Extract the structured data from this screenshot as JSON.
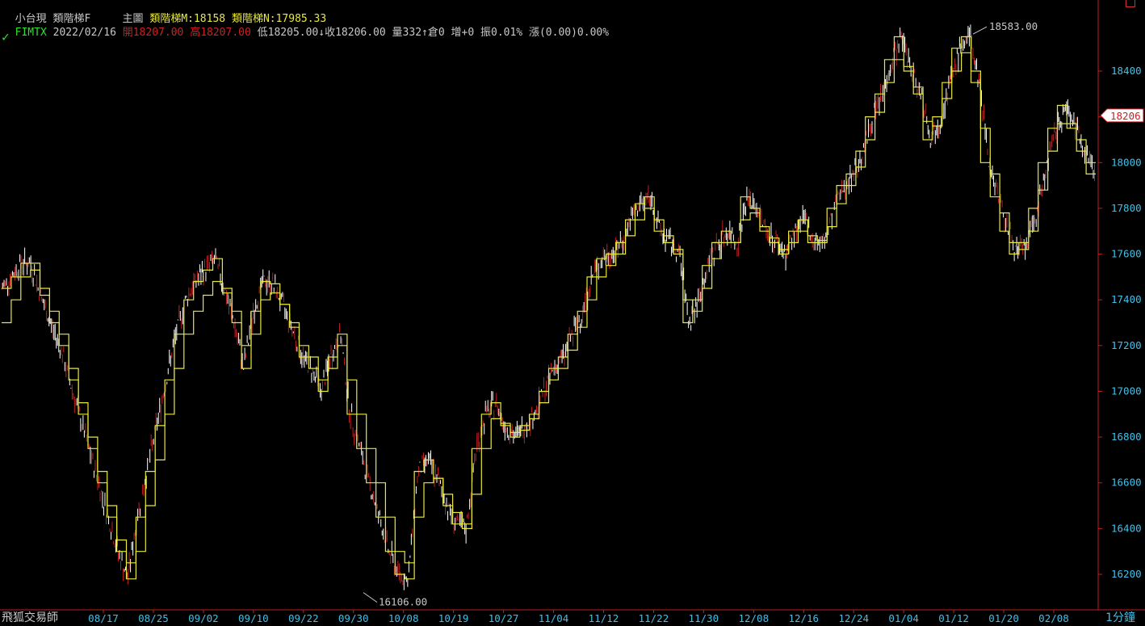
{
  "header": {
    "line1": {
      "product": "小台現",
      "indicator": "類階梯F",
      "panel": "主圖",
      "m_label": "類階梯M:18158",
      "n_label": "類階梯N:17985.33"
    },
    "line2": {
      "symbol": "FIMTX",
      "date": "2022/02/16",
      "open": "開18207.00",
      "high": "高18207.00",
      "low": "低18205.00",
      "close": "↓收18206.00",
      "volume": "量332",
      "oi": "↑倉0",
      "oi_change": "增+0",
      "amplitude": "振0.01%",
      "change": "漲(0.00)0.00%"
    }
  },
  "footer": {
    "brand": "飛狐交易師",
    "period": "1分鐘"
  },
  "colors": {
    "background": "#000000",
    "axis": "#40c0e8",
    "step_line": "#e8e840",
    "candle_up": "#ffffff",
    "candle_down": "#c02020"
  },
  "chart_data": {
    "type": "line",
    "y_range": [
      16100,
      18620
    ],
    "y_ticks": [
      16200,
      16400,
      16600,
      16800,
      17000,
      17200,
      17400,
      17600,
      17800,
      18000,
      18200,
      18400
    ],
    "x_tick_labels": [
      "08/17",
      "08/25",
      "09/02",
      "09/10",
      "09/22",
      "09/30",
      "10/08",
      "10/19",
      "10/27",
      "11/04",
      "11/12",
      "11/22",
      "11/30",
      "12/08",
      "12/16",
      "12/24",
      "01/04",
      "01/12",
      "01/20",
      "02/08"
    ],
    "last_price": "18206",
    "annotations": {
      "high": "18583.00",
      "low": "16106.00"
    },
    "series": [
      {
        "values": [
          17450,
          17500,
          17560,
          17560,
          17420,
          17300,
          17200,
          17050,
          16900,
          16750,
          16600,
          16450,
          16300,
          16180,
          16450,
          16650,
          16850,
          17050,
          17250,
          17400,
          17480,
          17530,
          17580,
          17450,
          17300,
          17100,
          17350,
          17480,
          17470,
          17380,
          17280,
          17150,
          17100,
          17000,
          17150,
          17250,
          16900,
          16750,
          16600,
          16450,
          16300,
          16200,
          16180,
          16650,
          16700,
          16620,
          16500,
          16420,
          16400,
          16750,
          16900,
          16950,
          16850,
          16800,
          16850,
          16900,
          17000,
          17100,
          17150,
          17250,
          17350,
          17500,
          17580,
          17600,
          17650,
          17750,
          17820,
          17850,
          17700,
          17650,
          17600,
          17300,
          17400,
          17550,
          17650,
          17700,
          17650,
          17850,
          17800,
          17700,
          17650,
          17600,
          17700,
          17750,
          17650,
          17650,
          17800,
          17900,
          17950,
          18050,
          18200,
          18300,
          18450,
          18550,
          18400,
          18300,
          18100,
          18200,
          18350,
          18500,
          18550,
          18350,
          18000,
          17850,
          17700,
          17600,
          17650,
          17800,
          18000,
          18150,
          18250,
          18150,
          18050,
          17950
        ]
      },
      {
        "values": [
          17300,
          17400,
          17500,
          17530,
          17450,
          17350,
          17250,
          17100,
          16950,
          16800,
          16650,
          16500,
          16350,
          16250,
          16300,
          16500,
          16700,
          16900,
          17100,
          17250,
          17350,
          17420,
          17480,
          17430,
          17350,
          17200,
          17250,
          17400,
          17430,
          17380,
          17300,
          17200,
          17150,
          17050,
          17100,
          17200,
          17050,
          16900,
          16750,
          16600,
          16450,
          16300,
          16250,
          16450,
          16600,
          16620,
          16550,
          16470,
          16420,
          16550,
          16750,
          16880,
          16860,
          16820,
          16830,
          16880,
          16950,
          17050,
          17100,
          17180,
          17280,
          17400,
          17500,
          17550,
          17600,
          17680,
          17750,
          17800,
          17750,
          17680,
          17620,
          17400,
          17350,
          17450,
          17580,
          17650,
          17650,
          17750,
          17780,
          17720,
          17670,
          17620,
          17650,
          17700,
          17680,
          17660,
          17720,
          17820,
          17900,
          17980,
          18100,
          18220,
          18350,
          18450,
          18420,
          18330,
          18180,
          18160,
          18280,
          18400,
          18480,
          18400,
          18150,
          17950,
          17780,
          17650,
          17620,
          17700,
          17880,
          18050,
          18170,
          18170,
          18100,
          18000
        ]
      }
    ]
  }
}
